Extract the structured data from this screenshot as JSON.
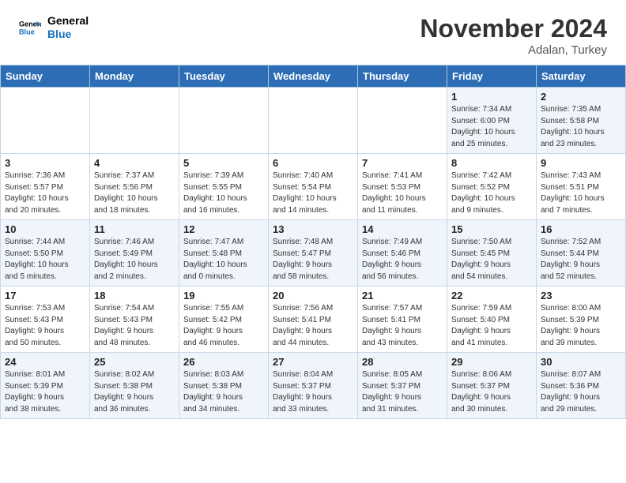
{
  "header": {
    "logo_general": "General",
    "logo_blue": "Blue",
    "month": "November 2024",
    "location": "Adalan, Turkey"
  },
  "weekdays": [
    "Sunday",
    "Monday",
    "Tuesday",
    "Wednesday",
    "Thursday",
    "Friday",
    "Saturday"
  ],
  "weeks": [
    [
      {
        "day": "",
        "info": ""
      },
      {
        "day": "",
        "info": ""
      },
      {
        "day": "",
        "info": ""
      },
      {
        "day": "",
        "info": ""
      },
      {
        "day": "",
        "info": ""
      },
      {
        "day": "1",
        "info": "Sunrise: 7:34 AM\nSunset: 6:00 PM\nDaylight: 10 hours\nand 25 minutes."
      },
      {
        "day": "2",
        "info": "Sunrise: 7:35 AM\nSunset: 5:58 PM\nDaylight: 10 hours\nand 23 minutes."
      }
    ],
    [
      {
        "day": "3",
        "info": "Sunrise: 7:36 AM\nSunset: 5:57 PM\nDaylight: 10 hours\nand 20 minutes."
      },
      {
        "day": "4",
        "info": "Sunrise: 7:37 AM\nSunset: 5:56 PM\nDaylight: 10 hours\nand 18 minutes."
      },
      {
        "day": "5",
        "info": "Sunrise: 7:39 AM\nSunset: 5:55 PM\nDaylight: 10 hours\nand 16 minutes."
      },
      {
        "day": "6",
        "info": "Sunrise: 7:40 AM\nSunset: 5:54 PM\nDaylight: 10 hours\nand 14 minutes."
      },
      {
        "day": "7",
        "info": "Sunrise: 7:41 AM\nSunset: 5:53 PM\nDaylight: 10 hours\nand 11 minutes."
      },
      {
        "day": "8",
        "info": "Sunrise: 7:42 AM\nSunset: 5:52 PM\nDaylight: 10 hours\nand 9 minutes."
      },
      {
        "day": "9",
        "info": "Sunrise: 7:43 AM\nSunset: 5:51 PM\nDaylight: 10 hours\nand 7 minutes."
      }
    ],
    [
      {
        "day": "10",
        "info": "Sunrise: 7:44 AM\nSunset: 5:50 PM\nDaylight: 10 hours\nand 5 minutes."
      },
      {
        "day": "11",
        "info": "Sunrise: 7:46 AM\nSunset: 5:49 PM\nDaylight: 10 hours\nand 2 minutes."
      },
      {
        "day": "12",
        "info": "Sunrise: 7:47 AM\nSunset: 5:48 PM\nDaylight: 10 hours\nand 0 minutes."
      },
      {
        "day": "13",
        "info": "Sunrise: 7:48 AM\nSunset: 5:47 PM\nDaylight: 9 hours\nand 58 minutes."
      },
      {
        "day": "14",
        "info": "Sunrise: 7:49 AM\nSunset: 5:46 PM\nDaylight: 9 hours\nand 56 minutes."
      },
      {
        "day": "15",
        "info": "Sunrise: 7:50 AM\nSunset: 5:45 PM\nDaylight: 9 hours\nand 54 minutes."
      },
      {
        "day": "16",
        "info": "Sunrise: 7:52 AM\nSunset: 5:44 PM\nDaylight: 9 hours\nand 52 minutes."
      }
    ],
    [
      {
        "day": "17",
        "info": "Sunrise: 7:53 AM\nSunset: 5:43 PM\nDaylight: 9 hours\nand 50 minutes."
      },
      {
        "day": "18",
        "info": "Sunrise: 7:54 AM\nSunset: 5:43 PM\nDaylight: 9 hours\nand 48 minutes."
      },
      {
        "day": "19",
        "info": "Sunrise: 7:55 AM\nSunset: 5:42 PM\nDaylight: 9 hours\nand 46 minutes."
      },
      {
        "day": "20",
        "info": "Sunrise: 7:56 AM\nSunset: 5:41 PM\nDaylight: 9 hours\nand 44 minutes."
      },
      {
        "day": "21",
        "info": "Sunrise: 7:57 AM\nSunset: 5:41 PM\nDaylight: 9 hours\nand 43 minutes."
      },
      {
        "day": "22",
        "info": "Sunrise: 7:59 AM\nSunset: 5:40 PM\nDaylight: 9 hours\nand 41 minutes."
      },
      {
        "day": "23",
        "info": "Sunrise: 8:00 AM\nSunset: 5:39 PM\nDaylight: 9 hours\nand 39 minutes."
      }
    ],
    [
      {
        "day": "24",
        "info": "Sunrise: 8:01 AM\nSunset: 5:39 PM\nDaylight: 9 hours\nand 38 minutes."
      },
      {
        "day": "25",
        "info": "Sunrise: 8:02 AM\nSunset: 5:38 PM\nDaylight: 9 hours\nand 36 minutes."
      },
      {
        "day": "26",
        "info": "Sunrise: 8:03 AM\nSunset: 5:38 PM\nDaylight: 9 hours\nand 34 minutes."
      },
      {
        "day": "27",
        "info": "Sunrise: 8:04 AM\nSunset: 5:37 PM\nDaylight: 9 hours\nand 33 minutes."
      },
      {
        "day": "28",
        "info": "Sunrise: 8:05 AM\nSunset: 5:37 PM\nDaylight: 9 hours\nand 31 minutes."
      },
      {
        "day": "29",
        "info": "Sunrise: 8:06 AM\nSunset: 5:37 PM\nDaylight: 9 hours\nand 30 minutes."
      },
      {
        "day": "30",
        "info": "Sunrise: 8:07 AM\nSunset: 5:36 PM\nDaylight: 9 hours\nand 29 minutes."
      }
    ]
  ]
}
